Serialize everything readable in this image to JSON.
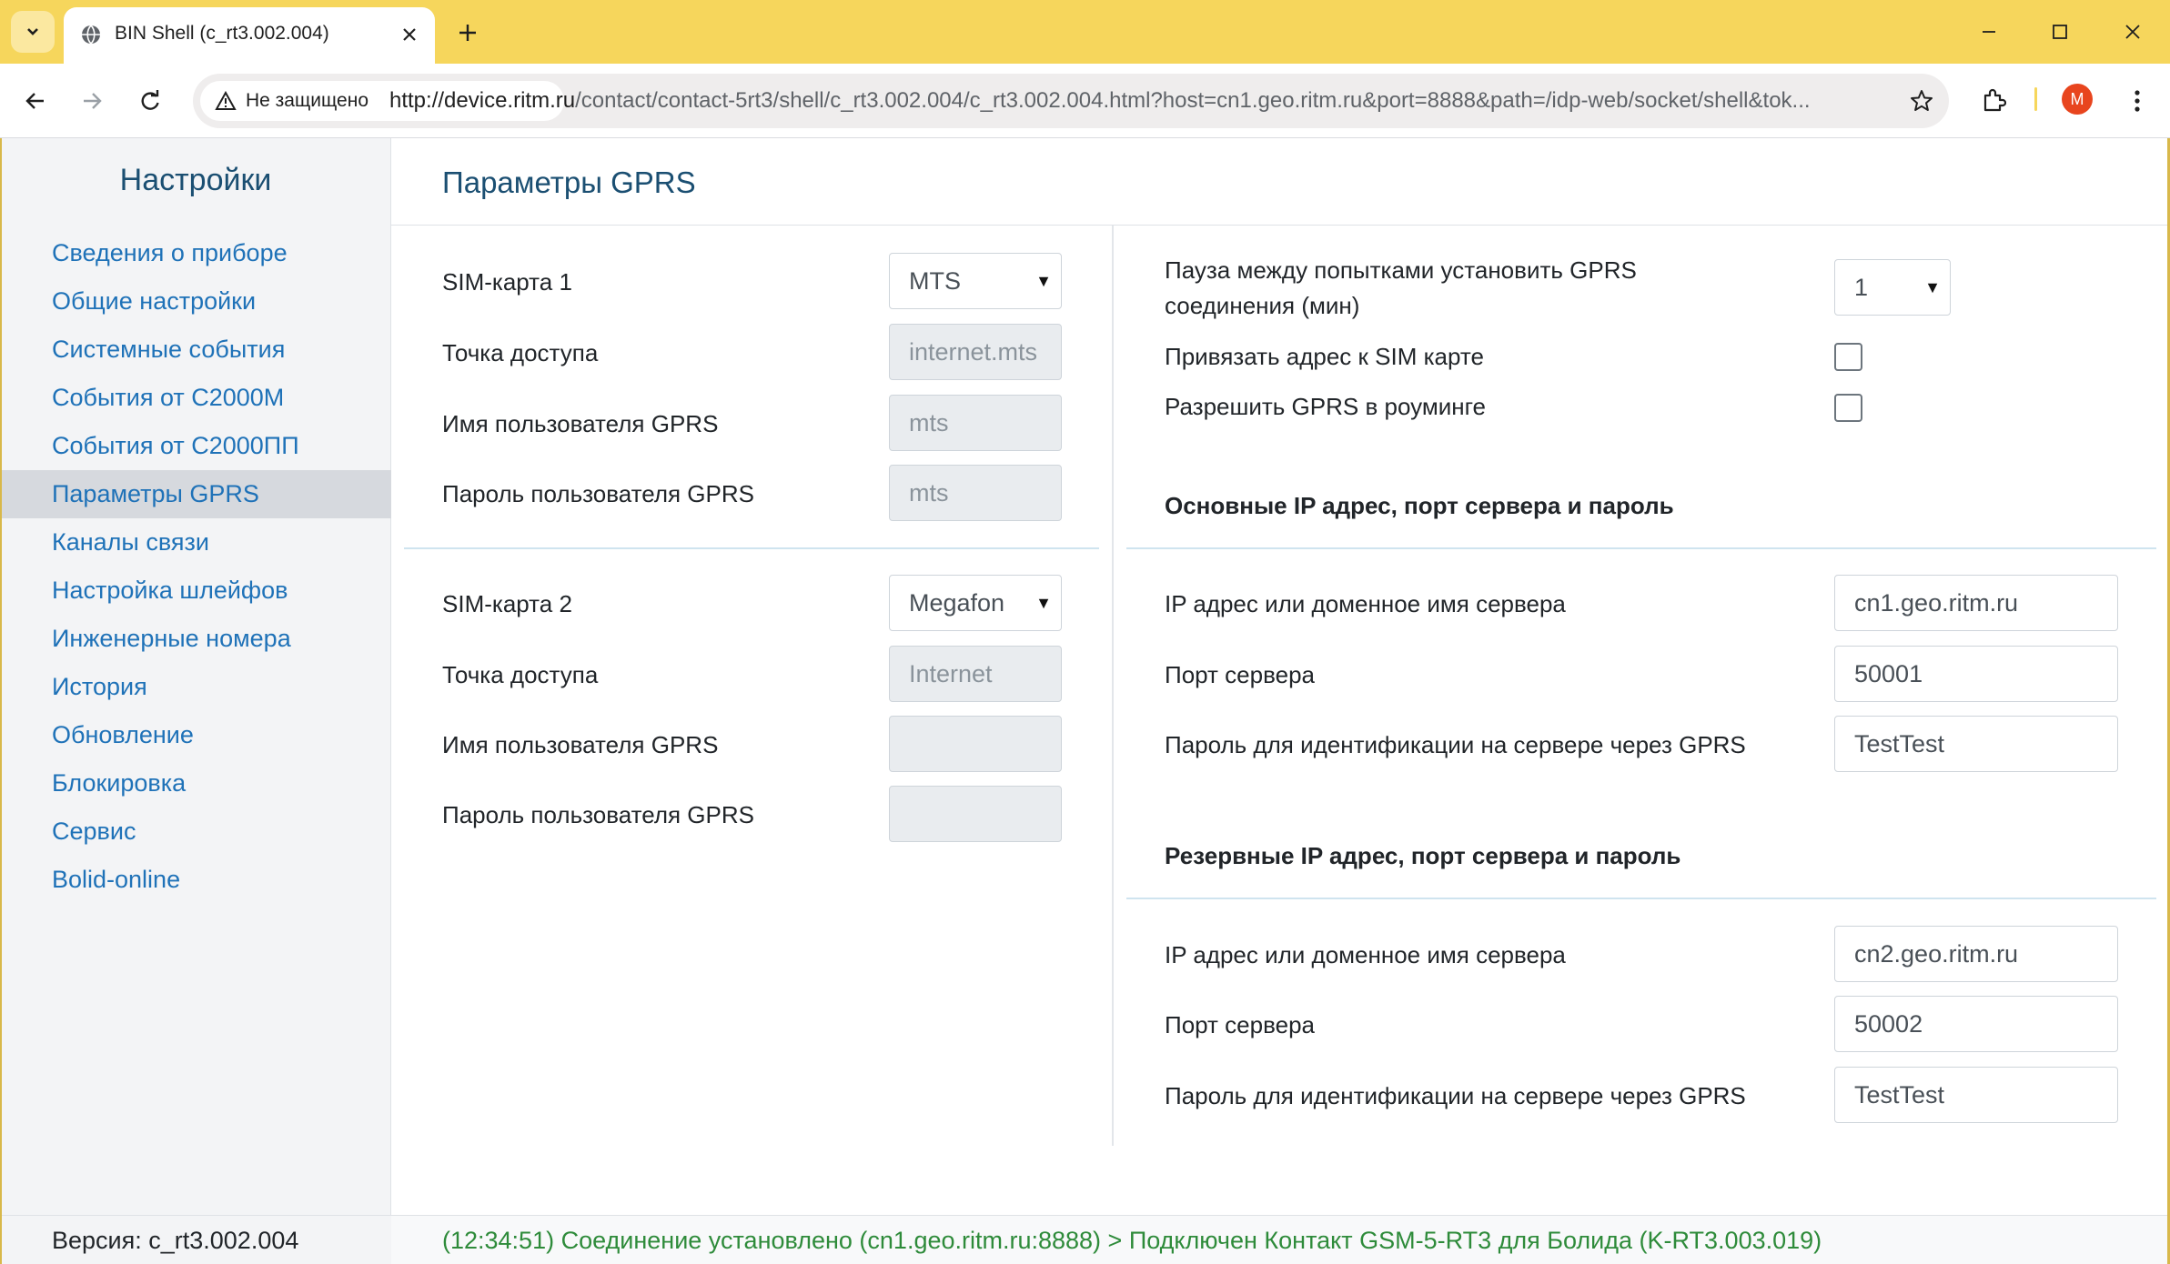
{
  "browser": {
    "tab_title": "BIN Shell (c_rt3.002.004)",
    "security_label": "Не защищено",
    "url_host": "http://device.ritm.ru",
    "url_rest": "/contact/contact-5rt3/shell/c_rt3.002.004/c_rt3.002.004.html?host=cn1.geo.ritm.ru&port=8888&path=/idp-web/socket/shell&tok...",
    "avatar_letter": "M",
    "accent": "#f6d65c"
  },
  "sidebar": {
    "title": "Настройки",
    "items": [
      {
        "label": "Сведения о приборе"
      },
      {
        "label": "Общие настройки"
      },
      {
        "label": "Системные события"
      },
      {
        "label": "События от С2000М"
      },
      {
        "label": "События от С2000ПП"
      },
      {
        "label": "Параметры GPRS",
        "active": true
      },
      {
        "label": "Каналы связи"
      },
      {
        "label": "Настройка шлейфов"
      },
      {
        "label": "Инженерные номера"
      },
      {
        "label": "История"
      },
      {
        "label": "Обновление"
      },
      {
        "label": "Блокировка"
      },
      {
        "label": "Сервис"
      },
      {
        "label": "Bolid-online"
      }
    ],
    "version": "Версия: c_rt3.002.004"
  },
  "main": {
    "title": "Параметры GPRS",
    "sim1": {
      "label": "SIM-карта 1",
      "value": "MTS",
      "apn_label": "Точка доступа",
      "apn_value": "internet.mts",
      "user_label": "Имя пользователя GPRS",
      "user_value": "mts",
      "pass_label": "Пароль пользователя GPRS",
      "pass_value": "mts"
    },
    "sim2": {
      "label": "SIM-карта 2",
      "value": "Megafon",
      "apn_label": "Точка доступа",
      "apn_value": "Internet",
      "user_label": "Имя пользователя GPRS",
      "user_value": "",
      "pass_label": "Пароль пользователя GPRS",
      "pass_value": ""
    },
    "pause": {
      "label_line1": "Пауза между попытками установить GPRS",
      "label_line2": "соединения (мин)",
      "value": "1"
    },
    "bind_sim": {
      "label": "Привязать адрес к SIM карте",
      "checked": false
    },
    "roaming": {
      "label": "Разрешить GPRS в роуминге",
      "checked": false
    },
    "primary": {
      "heading": "Основные IP адрес, порт сервера и пароль",
      "ip_label": "IP адрес или доменное имя сервера",
      "ip_value": "cn1.geo.ritm.ru",
      "port_label": "Порт сервера",
      "port_value": "50001",
      "pass_label": "Пароль для идентификации на сервере через GPRS",
      "pass_value": "TestTest"
    },
    "backup": {
      "heading": "Резервные IP адрес, порт сервера и пароль",
      "ip_label": "IP адрес или доменное имя сервера",
      "ip_value": "cn2.geo.ritm.ru",
      "port_label": "Порт сервера",
      "port_value": "50002",
      "pass_label": "Пароль для идентификации на сервере через GPRS",
      "pass_value": "TestTest"
    }
  },
  "status": {
    "text": "(12:34:51) Соединение установлено (cn1.geo.ritm.ru:8888) > Подключен Контакт GSM-5-RT3 для Болида (K-RT3.003.019)",
    "color": "#2e8b3a"
  }
}
